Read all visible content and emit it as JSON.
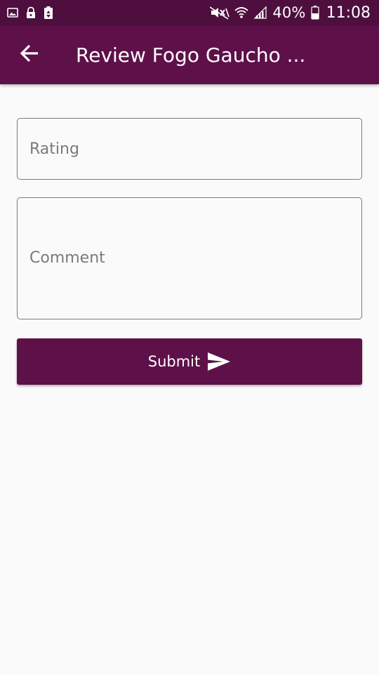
{
  "status_bar": {
    "battery": "40%",
    "time": "11:08",
    "icons": [
      "image-icon",
      "lock-icon",
      "recycle-icon",
      "mute-icon",
      "wifi-icon",
      "signal-icon",
      "battery-icon"
    ]
  },
  "app_bar": {
    "back_icon": "arrow-back-icon",
    "title": "Review Fogo Gaucho ..."
  },
  "form": {
    "rating_placeholder": "Rating",
    "rating_value": "",
    "comment_placeholder": "Comment",
    "comment_value": "",
    "submit_label": "Submit",
    "submit_icon": "send-icon"
  },
  "colors": {
    "status_bar": "#4e0f3f",
    "primary": "#5e1049",
    "background": "#fafafa",
    "outline": "#7a7a7a"
  }
}
